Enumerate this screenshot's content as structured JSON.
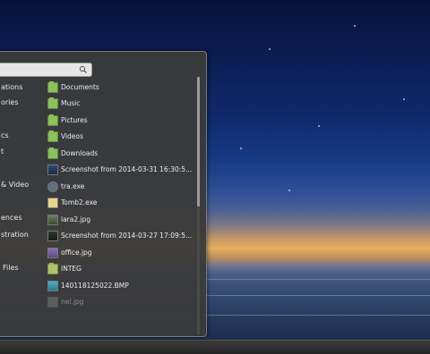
{
  "categories": [
    {
      "label": "ations"
    },
    {
      "label": "ories"
    },
    {
      "label": "cs"
    },
    {
      "label": "t"
    },
    {
      "label": "& Video"
    },
    {
      "label": "ences"
    },
    {
      "label": "stration"
    },
    {
      "label": "Files"
    }
  ],
  "items": [
    {
      "label": "Documents",
      "icon": "folder-documents-icon"
    },
    {
      "label": "Music",
      "icon": "folder-music-icon"
    },
    {
      "label": "Pictures",
      "icon": "folder-pictures-icon"
    },
    {
      "label": "Videos",
      "icon": "folder-videos-icon"
    },
    {
      "label": "Downloads",
      "icon": "folder-downloads-icon"
    },
    {
      "label": "Screenshot from 2014-03-31 16:30:5...",
      "icon": "screenshot-file-icon"
    },
    {
      "label": "tra.exe",
      "icon": "exe-file-icon"
    },
    {
      "label": "Tomb2.exe",
      "icon": "exe-file-icon"
    },
    {
      "label": "lara2.jpg",
      "icon": "image-file-icon"
    },
    {
      "label": "Screenshot from 2014-03-27 17:09:5...",
      "icon": "screenshot-file-icon"
    },
    {
      "label": "office.jpg",
      "icon": "image-file-icon"
    },
    {
      "label": "INTEG",
      "icon": "folder-icon"
    },
    {
      "label": "140118125022.BMP",
      "icon": "image-file-icon"
    },
    {
      "label": "nel.jpg",
      "icon": "image-file-icon"
    }
  ],
  "search": {
    "value": "",
    "icon": "search-icon"
  },
  "colors": {
    "menu_bg": "#3a3a3a",
    "folder_green": "#8dbf5a",
    "text": "#ececec"
  }
}
